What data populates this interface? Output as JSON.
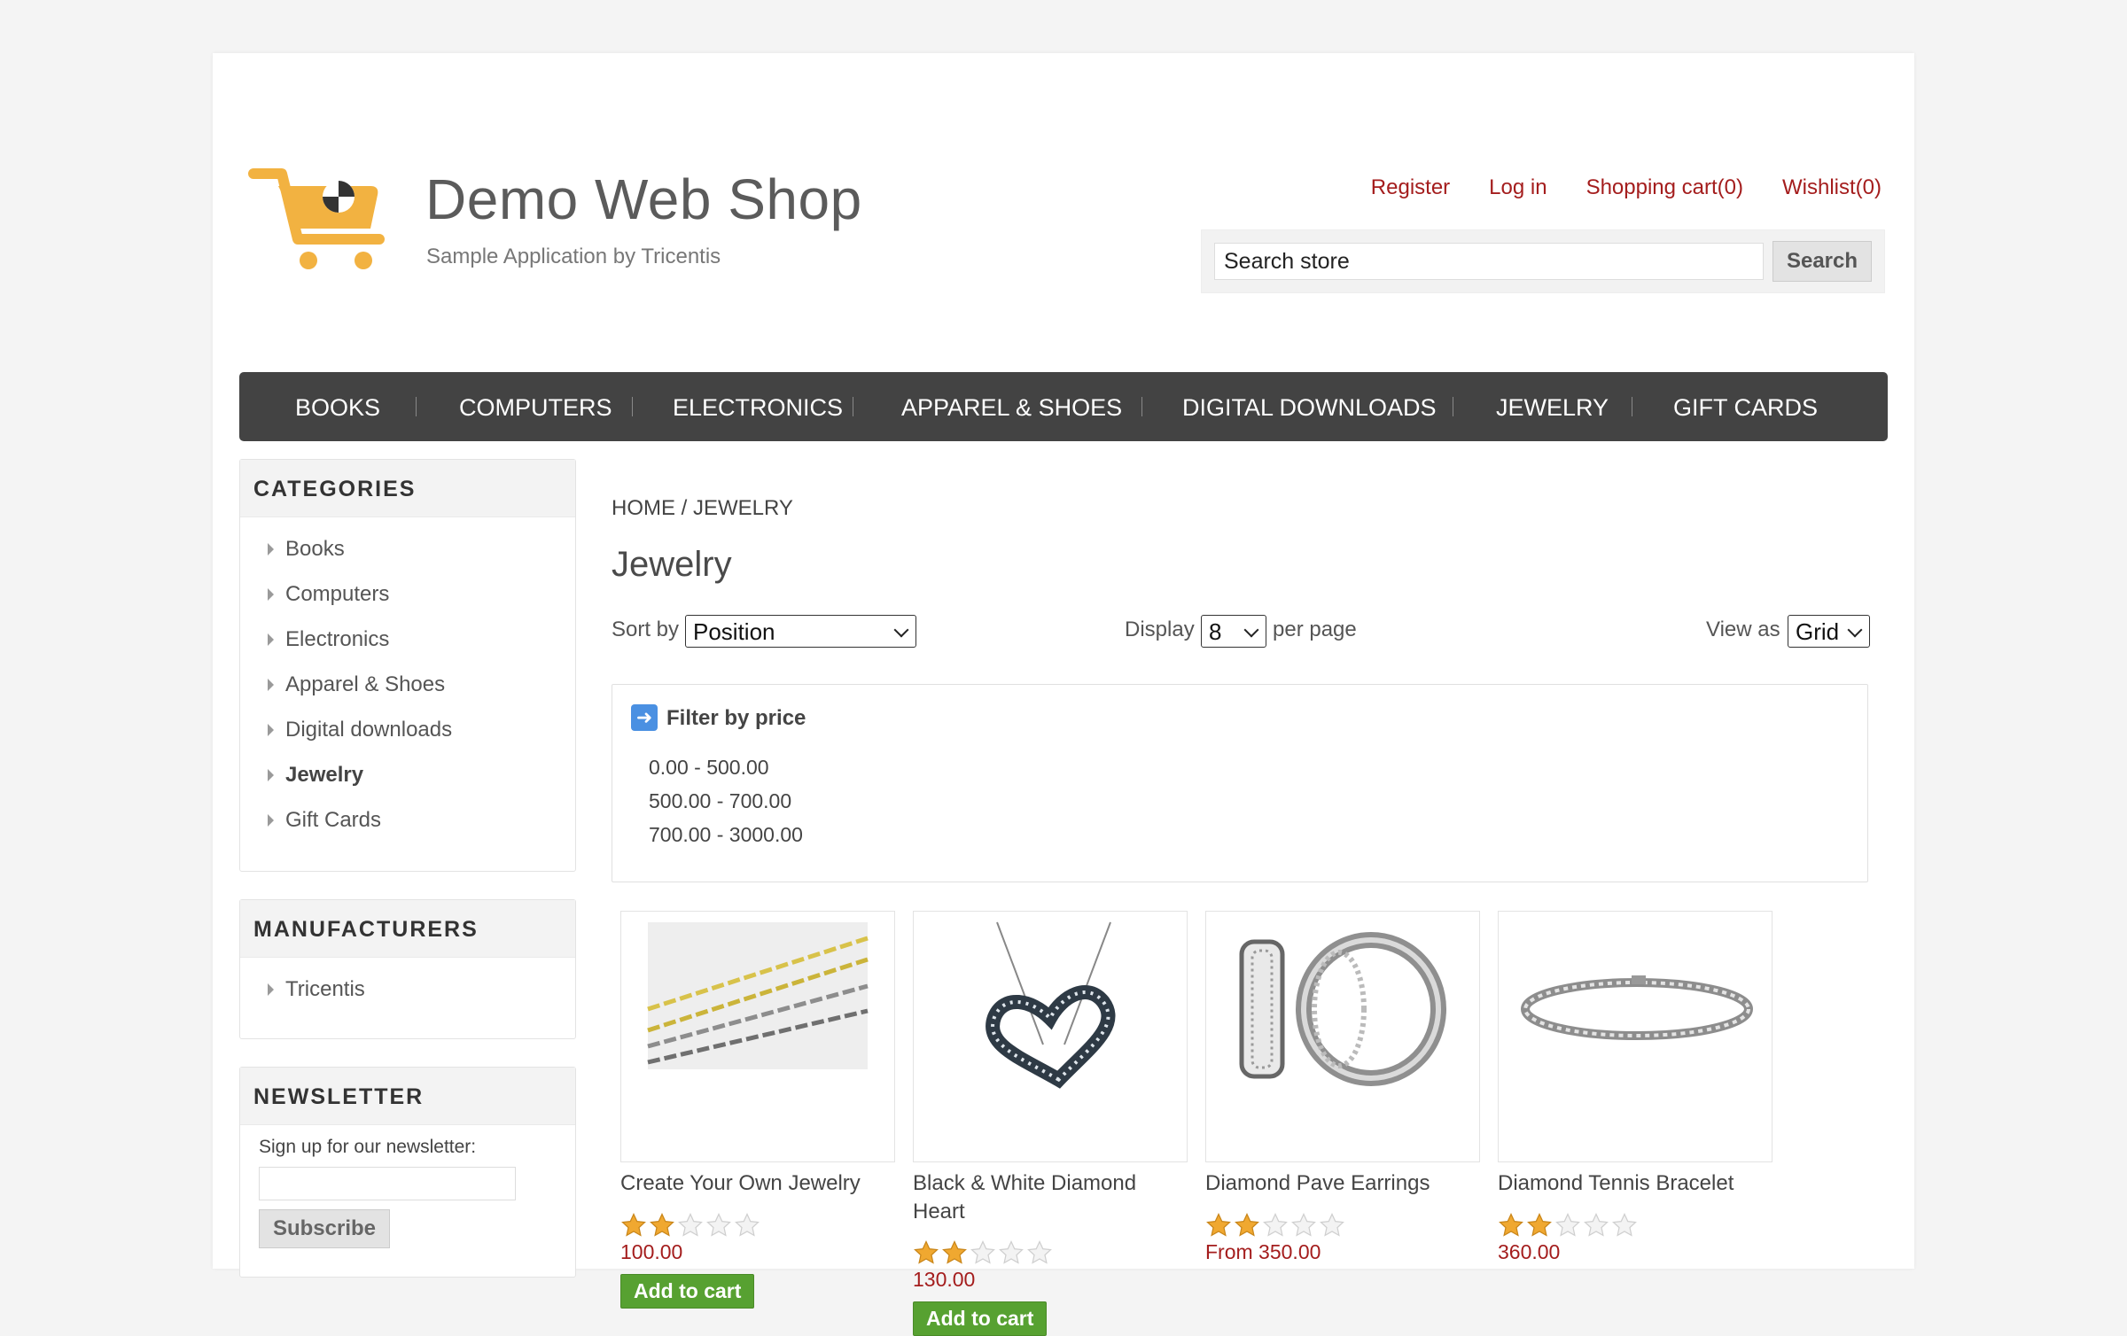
{
  "header": {
    "logo_title": "Demo Web Shop",
    "logo_subtitle": "Sample Application by Tricentis",
    "links": {
      "register": "Register",
      "login": "Log in",
      "cart": "Shopping cart(0)",
      "wishlist": "Wishlist(0)"
    },
    "search": {
      "value": "Search store",
      "button": "Search"
    }
  },
  "top_menu": [
    "BOOKS",
    "COMPUTERS",
    "ELECTRONICS",
    "APPAREL & SHOES",
    "DIGITAL DOWNLOADS",
    "JEWELRY",
    "GIFT CARDS"
  ],
  "sidebar": {
    "categories": {
      "title": "CATEGORIES",
      "items": [
        "Books",
        "Computers",
        "Electronics",
        "Apparel & Shoes",
        "Digital downloads",
        "Jewelry",
        "Gift Cards"
      ],
      "active": "Jewelry"
    },
    "manufacturers": {
      "title": "MANUFACTURERS",
      "items": [
        "Tricentis"
      ]
    },
    "newsletter": {
      "title": "NEWSLETTER",
      "label": "Sign up for our newsletter:",
      "input_value": "",
      "button": "Subscribe"
    }
  },
  "main": {
    "breadcrumb": {
      "home": "HOME",
      "sep": "/",
      "current": "JEWELRY"
    },
    "title": "Jewelry",
    "sort": {
      "label": "Sort by",
      "value": "Position"
    },
    "display": {
      "label": "Display",
      "value": "8",
      "suffix": "per page"
    },
    "view": {
      "label": "View as",
      "value": "Grid"
    },
    "filter": {
      "title": "Filter by price",
      "ranges": [
        "0.00 - 500.00",
        "500.00 - 700.00",
        "700.00 - 3000.00"
      ]
    },
    "products": [
      {
        "title": "Create Your Own Jewelry",
        "rating": 2,
        "price": "100.00",
        "button": "Add to cart",
        "image_icon": "gold-silver-chains-image"
      },
      {
        "title": "Black & White Diamond Heart",
        "rating": 2,
        "price": "130.00",
        "button": "Add to cart",
        "image_icon": "heart-pendant-image"
      },
      {
        "title": "Diamond Pave Earrings",
        "rating": 2,
        "price": "From 350.00",
        "image_icon": "hoop-earrings-image"
      },
      {
        "title": "Diamond Tennis Bracelet",
        "rating": 2,
        "price": "360.00",
        "image_icon": "tennis-bracelet-image"
      }
    ]
  },
  "colors": {
    "link_red": "#a41d1d",
    "menu_bg": "#434343",
    "cart_green": "#57a131",
    "star_gold": "#f0a830",
    "logo_orange": "#f2b241"
  }
}
